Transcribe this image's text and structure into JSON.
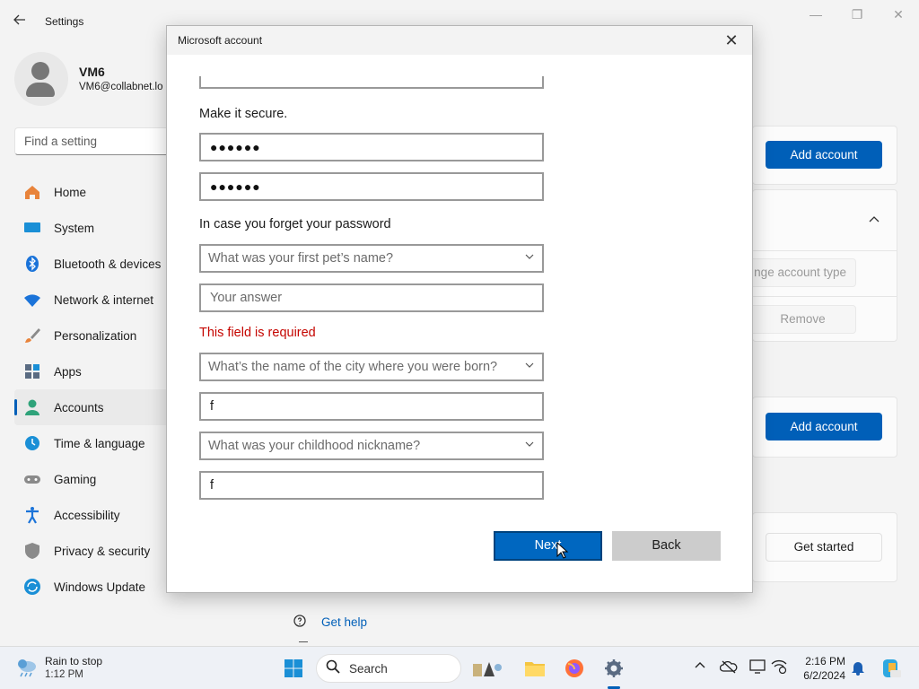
{
  "settings": {
    "title": "Settings",
    "user": {
      "name": "VM6",
      "email": "VM6@collabnet.lo"
    },
    "search_placeholder": "Find a setting",
    "nav": [
      {
        "label": "Home",
        "icon": "home-icon"
      },
      {
        "label": "System",
        "icon": "system-icon"
      },
      {
        "label": "Bluetooth & devices",
        "icon": "bluetooth-icon"
      },
      {
        "label": "Network & internet",
        "icon": "network-icon"
      },
      {
        "label": "Personalization",
        "icon": "brush-icon"
      },
      {
        "label": "Apps",
        "icon": "apps-icon"
      },
      {
        "label": "Accounts",
        "icon": "accounts-icon",
        "active": true
      },
      {
        "label": "Time & language",
        "icon": "clock-icon"
      },
      {
        "label": "Gaming",
        "icon": "gamepad-icon"
      },
      {
        "label": "Accessibility",
        "icon": "accessibility-icon"
      },
      {
        "label": "Privacy & security",
        "icon": "shield-icon"
      },
      {
        "label": "Windows Update",
        "icon": "update-icon"
      }
    ],
    "content": {
      "add_account_1": "Add account",
      "change_account_type": "nge account type",
      "remove": "Remove",
      "add_account_2": "Add account",
      "get_started": "Get started",
      "get_help": "Get help"
    }
  },
  "dialog": {
    "title": "Microsoft account",
    "make_secure_label": "Make it secure.",
    "password_mask": "●●●●●●",
    "confirm_mask": "●●●●●●",
    "forget_label": "In case you forget your password",
    "q1": "What was your first pet’s name?",
    "a1_placeholder": "Your answer",
    "error": "This field is required",
    "q2": "What’s the name of the city where you were born?",
    "a2": "f",
    "q3": "What was your childhood nickname?",
    "a3": "f",
    "next": "Next",
    "back": "Back"
  },
  "taskbar": {
    "weather_title": "Rain to stop",
    "weather_time": "1:12 PM",
    "search": "Search",
    "time": "2:16 PM",
    "date": "6/2/2024"
  },
  "colors": {
    "accent": "#005fb8",
    "error": "#c50500",
    "dialog_button": "#0067c0"
  }
}
